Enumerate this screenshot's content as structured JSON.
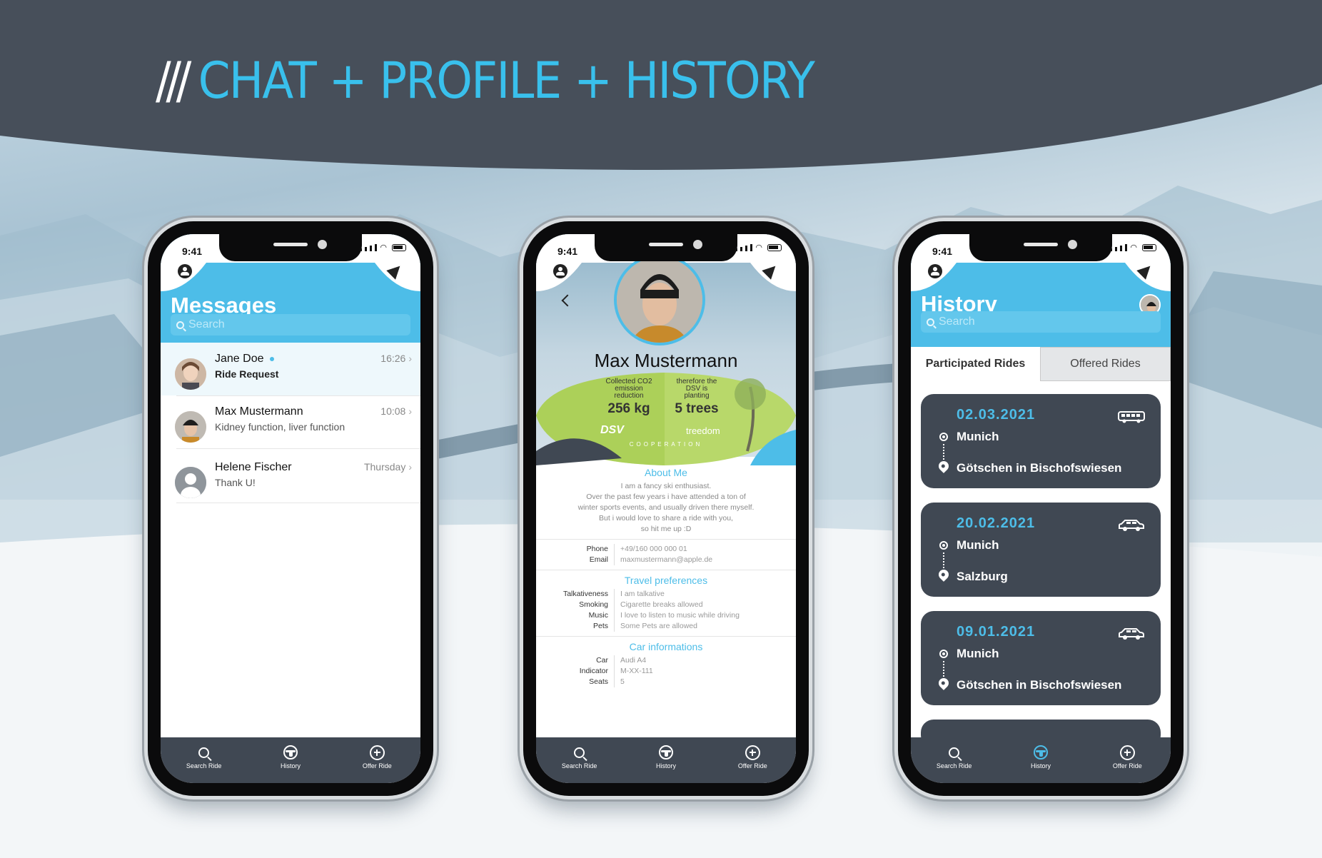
{
  "header": {
    "slashes": "///",
    "title": "CHAT + PROFILE + HISTORY"
  },
  "colors": {
    "accent": "#4dbde8",
    "dark": "#404853",
    "title": "#39c0ec"
  },
  "status": {
    "time": "9:41"
  },
  "tabbar": {
    "search": "Search Ride",
    "history": "History",
    "offer": "Offer Ride"
  },
  "messages": {
    "title": "Messages",
    "search_placeholder": "Search",
    "chats": [
      {
        "name": "Jane Doe",
        "sub": "Ride Request",
        "time": "16:26",
        "unread": true
      },
      {
        "name": "Max Mustermann",
        "sub": "Kidney function, liver function",
        "time": "10:08"
      },
      {
        "name": "Helene Fischer",
        "sub": "Thank U!",
        "time": "Thursday"
      }
    ]
  },
  "profile": {
    "name": "Max Mustermann",
    "eco": {
      "collected_label": "Collected CO2 emission reduction",
      "collected_value": "256 kg",
      "therefore_label": "therefore the DSV is planting",
      "trees_value": "5 trees",
      "logo1": "DSV",
      "logo2": "treedom",
      "cooperation": "COOPERATION"
    },
    "about_title": "About Me",
    "about_lines": [
      "I am a fancy ski enthusiast.",
      "Over the past few years i have attended a ton of",
      "winter sports events, and usually driven there myself.",
      "But i would love to share a ride with you,",
      "so hit me up :D"
    ],
    "contact": [
      {
        "k": "Phone",
        "v": "+49/160 000 000 01"
      },
      {
        "k": "Email",
        "v": "maxmustermann@apple.de"
      }
    ],
    "travel_title": "Travel preferences",
    "travel": [
      {
        "k": "Talkativeness",
        "v": "I am talkative"
      },
      {
        "k": "Smoking",
        "v": "Cigarette breaks allowed"
      },
      {
        "k": "Music",
        "v": "I love to listen to music while driving"
      },
      {
        "k": "Pets",
        "v": "Some Pets are allowed"
      }
    ],
    "car_title": "Car informations",
    "car": [
      {
        "k": "Car",
        "v": "Audi A4"
      },
      {
        "k": "Indicator",
        "v": "M-XX-111"
      },
      {
        "k": "Seats",
        "v": "5"
      }
    ]
  },
  "history": {
    "title": "History",
    "search_placeholder": "Search",
    "tab_participated": "Participated Rides",
    "tab_offered": "Offered Rides",
    "rides": [
      {
        "date": "02.03.2021",
        "from": "Munich",
        "to": "Götschen in Bischofswiesen",
        "vehicle": "bus-icon"
      },
      {
        "date": "20.02.2021",
        "from": "Munich",
        "to": "Salzburg",
        "vehicle": "car-icon"
      },
      {
        "date": "09.01.2021",
        "from": "Munich",
        "to": "Götschen in Bischofswiesen",
        "vehicle": "car-icon"
      }
    ]
  }
}
